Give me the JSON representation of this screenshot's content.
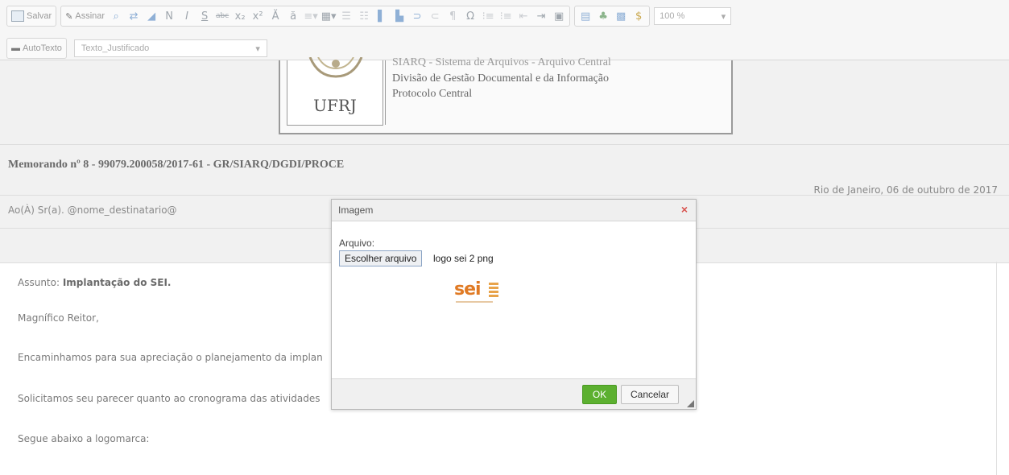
{
  "toolbar": {
    "save_label": "Salvar",
    "sign_label": "Assinar",
    "bold_glyph": "N",
    "italic_glyph": "I",
    "underline_glyph": "S",
    "strike_glyph": "abc",
    "omega_glyph": "Ω",
    "pilcrow_glyph": "¶",
    "dollar_glyph": "$",
    "zoom_value": "100 %",
    "autotext_label": "AutoTexto",
    "style_value": "Texto_Justificado"
  },
  "header": {
    "org_line1": "SIARQ - Sistema de Arquivos - Arquivo Central",
    "org_line2": "Divisão de Gestão Documental e da Informação",
    "org_line3": "Protocolo Central",
    "seal_text": "UFRJ"
  },
  "memo": {
    "title": "Memorando nº 8 - 99079.200058/2017-61 - GR/SIARQ/DGDI/PROCE",
    "date": "Rio de Janeiro, 06 de outubro de 2017",
    "recipient": "Ao(À) Sr(a). @nome_destinatario@",
    "subject_label": "Assunto: ",
    "subject_value": "Implantação do SEI.",
    "salutation": "Magnífico Reitor,",
    "para1": "Encaminhamos para sua apreciação o planejamento da implan",
    "para2": "Solicitamos seu parecer quanto ao cronograma das atividades",
    "para3": "Segue abaixo a logomarca:"
  },
  "dialog": {
    "title": "Imagem",
    "close_glyph": "×",
    "file_label": "Arquivo:",
    "choose_button": "Escolher arquivo",
    "file_name": "logo sei 2 png",
    "preview_logo_text": "sei",
    "ok_label": "OK",
    "cancel_label": "Cancelar"
  },
  "colors": {
    "ok_green": "#5cb030",
    "close_red": "#d9534f",
    "sei_orange": "#e07a24"
  },
  "icons": [
    "save-icon",
    "sign-icon",
    "find-icon",
    "replace-icon",
    "eraser-icon",
    "subscript-icon",
    "superscript-icon",
    "text-color-icon",
    "bg-color-icon",
    "list-style-icon",
    "table-icon",
    "align-left-icon",
    "align-center-icon",
    "align-right-icon",
    "align-justify-icon",
    "indent-icon",
    "outdent-icon",
    "image-icon",
    "spellcheck-icon",
    "autotext-icon",
    "dollar-icon"
  ]
}
